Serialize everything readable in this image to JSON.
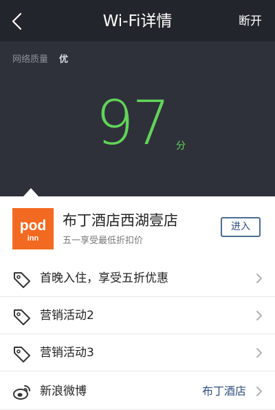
{
  "header": {
    "title": "Wi-Fi详情",
    "right_action": "断开"
  },
  "quality": {
    "label": "网络质量",
    "value": "优",
    "score": "97",
    "unit": "分"
  },
  "business": {
    "name": "布丁酒店西湖壹店",
    "subtitle": "五一享受最低折扣价",
    "enter_label": "进入",
    "logo": {
      "line1": "pod",
      "line2": "inn"
    }
  },
  "rows": [
    {
      "icon": "tag-icon",
      "text": "首晚入住，享受五折优惠"
    },
    {
      "icon": "tag-icon",
      "text": "营销活动2"
    },
    {
      "icon": "tag-icon",
      "text": "营销活动3"
    },
    {
      "icon": "weibo-icon",
      "text": "新浪微博",
      "value": "布丁酒店"
    }
  ],
  "colors": {
    "header_bg": "#23252c",
    "panel_bg": "#2f313a",
    "score_green": "#62d45a",
    "logo_orange": "#f26a21",
    "link_blue": "#2f4f7f"
  }
}
